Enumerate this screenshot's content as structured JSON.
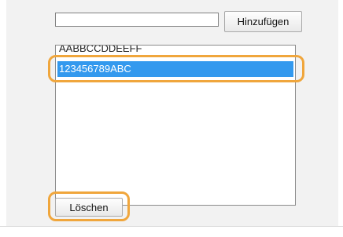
{
  "form": {
    "input_value": "",
    "add_label": "Hinzufügen",
    "delete_label": "Löschen"
  },
  "list": {
    "items": [
      {
        "label": "AABBCCDDEEFF",
        "selected": false
      },
      {
        "label": "123456789ABC",
        "selected": true
      }
    ]
  },
  "colors": {
    "selection": "#3399ee",
    "highlight_ring": "#f0a63c",
    "panel_background": "#f2f2f2"
  }
}
